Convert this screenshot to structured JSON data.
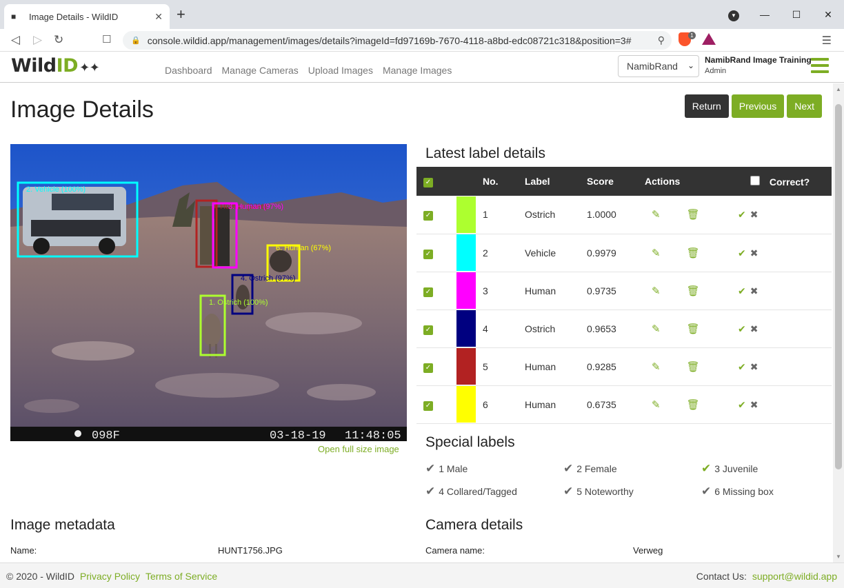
{
  "browser": {
    "tab_title": "Image Details - WildID",
    "url": "console.wildid.app/management/images/details?imageId=fd97169b-7670-4118-a8bd-edc08721c318&position=3#",
    "shield_count": "1"
  },
  "app": {
    "logo_main": "Wild",
    "logo_accent": "ID",
    "nav": [
      "Dashboard",
      "Manage Cameras",
      "Upload Images",
      "Manage Images"
    ],
    "org_select": "NamibRand",
    "org_name": "NamibRand Image Training",
    "user_role": "Admin"
  },
  "page": {
    "title": "Image Details",
    "buttons": {
      "return": "Return",
      "previous": "Previous",
      "next": "Next"
    },
    "open_full": "Open full size image"
  },
  "photo": {
    "camera_id": "098F",
    "date": "03-18-19",
    "time": "11:48:05",
    "boxes": [
      {
        "text": "2. Vehicle (100%)",
        "color": "#00ffff"
      },
      {
        "text": "5. Human (93%)",
        "color": "#b22222"
      },
      {
        "text": "3. Human (97%)",
        "color": "#ff00ff"
      },
      {
        "text": "6. Human (67%)",
        "color": "#ffff00"
      },
      {
        "text": "4. Ostrich (97%)",
        "color": "#000080"
      },
      {
        "text": "1. Ostrich (100%)",
        "color": "#adff2f"
      }
    ]
  },
  "labels": {
    "title": "Latest label details",
    "headers": {
      "no": "No.",
      "label": "Label",
      "score": "Score",
      "actions": "Actions",
      "correct": "Correct?"
    },
    "rows": [
      {
        "no": "1",
        "label": "Ostrich",
        "score": "1.0000",
        "color": "#adff2f"
      },
      {
        "no": "2",
        "label": "Vehicle",
        "score": "0.9979",
        "color": "#00ffff"
      },
      {
        "no": "3",
        "label": "Human",
        "score": "0.9735",
        "color": "#ff00ff"
      },
      {
        "no": "4",
        "label": "Ostrich",
        "score": "0.9653",
        "color": "#000080"
      },
      {
        "no": "5",
        "label": "Human",
        "score": "0.9285",
        "color": "#b22222"
      },
      {
        "no": "6",
        "label": "Human",
        "score": "0.6735",
        "color": "#ffff00"
      }
    ]
  },
  "special": {
    "title": "Special labels",
    "items": [
      {
        "text": "1 Male",
        "checked": false
      },
      {
        "text": "2 Female",
        "checked": false
      },
      {
        "text": "3 Juvenile",
        "checked": true
      },
      {
        "text": "4 Collared/Tagged",
        "checked": false
      },
      {
        "text": "5 Noteworthy",
        "checked": false
      },
      {
        "text": "6 Missing box",
        "checked": false
      }
    ]
  },
  "metadata": {
    "title": "Image metadata",
    "name_label": "Name:",
    "name_value": "HUNT1756.JPG"
  },
  "camera": {
    "title": "Camera details",
    "name_label": "Camera name:",
    "name_value": "Verweg"
  },
  "footer": {
    "copyright": "© 2020 - WildID",
    "privacy": "Privacy Policy",
    "terms": "Terms of Service",
    "contact_label": "Contact Us:",
    "contact_email": "support@wildid.app"
  },
  "colors": {
    "accent": "#7dad24",
    "dark": "#333333"
  }
}
